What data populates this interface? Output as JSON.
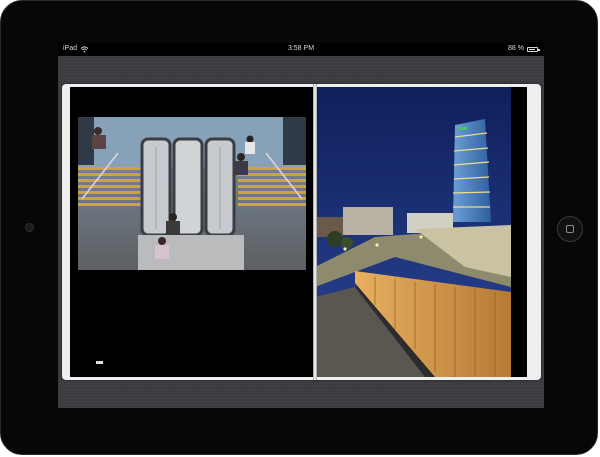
{
  "status_bar": {
    "device_label": "iPad",
    "time": "3:58 PM",
    "battery_percent": "88 %",
    "battery_level": 0.88,
    "wifi_icon": "wifi-icon",
    "battery_icon": "battery-icon"
  },
  "book": {
    "left_photo": "escalator-photo",
    "right_photo": "tower-photo"
  },
  "colors": {
    "screen_background": "#3b3d42",
    "device_frame": "#070707",
    "page_background": "#000000",
    "sky": "#1b2a6e",
    "wood": "#d9a355"
  }
}
